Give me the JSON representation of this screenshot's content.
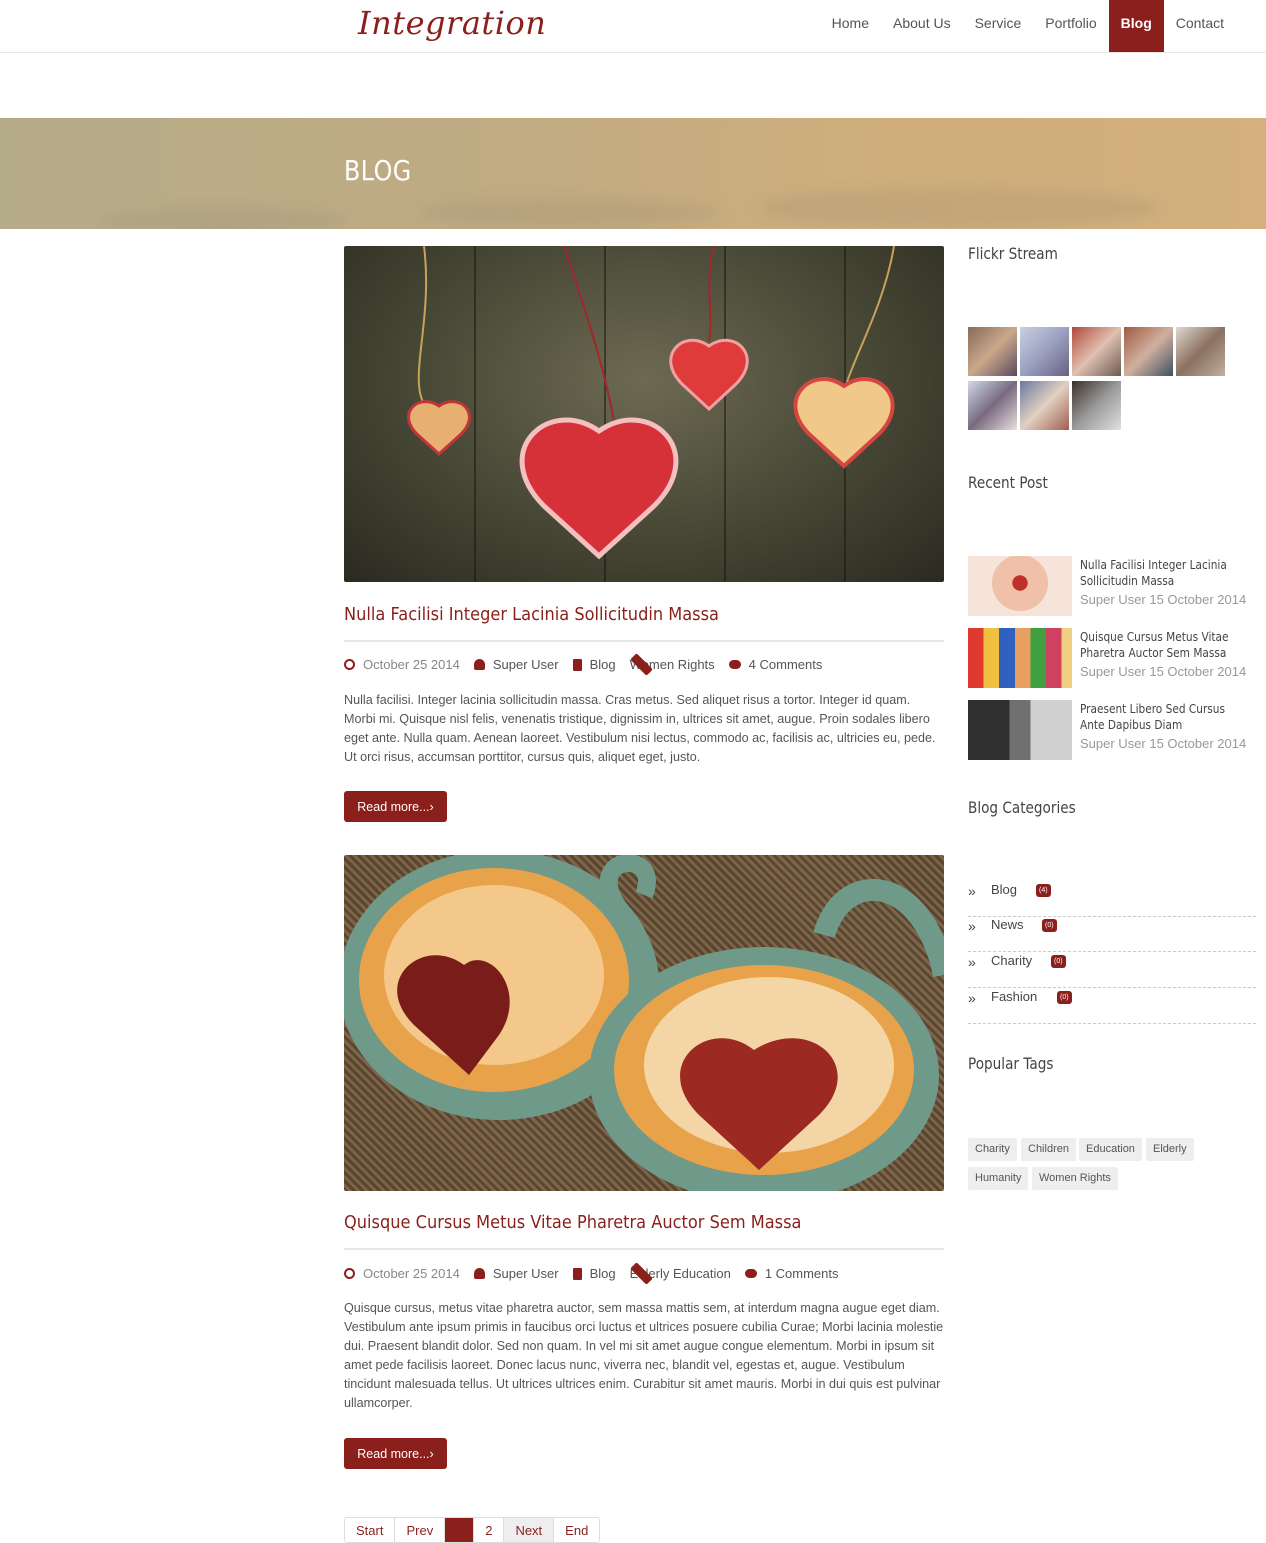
{
  "site": {
    "logo": "Integration"
  },
  "nav": {
    "items": [
      "Home",
      "About Us",
      "Service",
      "Portfolio",
      "Blog",
      "Contact"
    ],
    "active": "Blog"
  },
  "banner": {
    "title": "BLOG"
  },
  "posts": [
    {
      "title": "Nulla Facilisi Integer Lacinia Sollicitudin Massa",
      "date": "October 25 2014",
      "author": "Super User",
      "category": "Blog",
      "tags": "Women Rights",
      "comments": "4 Comments",
      "excerpt": "Nulla facilisi. Integer lacinia sollicitudin massa. Cras metus. Sed aliquet risus a tortor. Integer id quam. Morbi mi. Quisque nisl felis, venenatis tristique, dignissim in, ultrices sit amet, augue. Proin sodales libero eget ante. Nulla quam. Aenean laoreet. Vestibulum nisi lectus, commodo ac, facilisis ac, ultricies eu, pede. Ut orci risus, accumsan porttitor, cursus quis, aliquet eget, justo.",
      "read_more": "Read more...›"
    },
    {
      "title": "Quisque Cursus Metus Vitae Pharetra Auctor Sem Massa",
      "date": "October 25 2014",
      "author": "Super User",
      "category": "Blog",
      "tags": "Elderly Education",
      "comments": "1 Comments",
      "excerpt": "Quisque cursus, metus vitae pharetra auctor, sem massa mattis sem, at interdum magna augue eget diam. Vestibulum ante ipsum primis in faucibus orci luctus et ultrices posuere cubilia Curae; Morbi lacinia molestie dui. Praesent blandit dolor. Sed non quam. In vel mi sit amet augue congue elementum. Morbi in ipsum sit amet pede facilisis laoreet. Donec lacus nunc, viverra nec, blandit vel, egestas et, augue. Vestibulum tincidunt malesuada tellus. Ut ultrices ultrices enim. Curabitur sit amet mauris. Morbi in dui quis est pulvinar ullamcorper.",
      "read_more": "Read more...›"
    }
  ],
  "pagination": {
    "start": "Start",
    "prev": "Prev",
    "current": "1",
    "page2": "2",
    "next": "Next",
    "end": "End"
  },
  "sidebar": {
    "flickr_title": "Flickr Stream",
    "recent_title": "Recent Post",
    "recent": [
      {
        "title": "Nulla Facilisi Integer Lacinia Sollicitudin Massa",
        "meta": "Super User 15 October 2014"
      },
      {
        "title": "Quisque Cursus Metus Vitae Pharetra Auctor Sem Massa",
        "meta": "Super User 15 October 2014"
      },
      {
        "title": "Praesent Libero Sed Cursus Ante Dapibus Diam",
        "meta": "Super User 15 October 2014"
      }
    ],
    "categories_title": "Blog Categories",
    "categories": [
      {
        "name": "Blog",
        "count": "(4)"
      },
      {
        "name": "News",
        "count": "(0)"
      },
      {
        "name": "Charity",
        "count": "(0)"
      },
      {
        "name": "Fashion",
        "count": "(0)"
      }
    ],
    "tags_title": "Popular Tags",
    "tags": [
      "Charity",
      "Children",
      "Education",
      "Elderly",
      "Humanity",
      "Women Rights"
    ]
  },
  "colors": {
    "accent": "#8b1f1b",
    "banner": "#c9ac80"
  }
}
